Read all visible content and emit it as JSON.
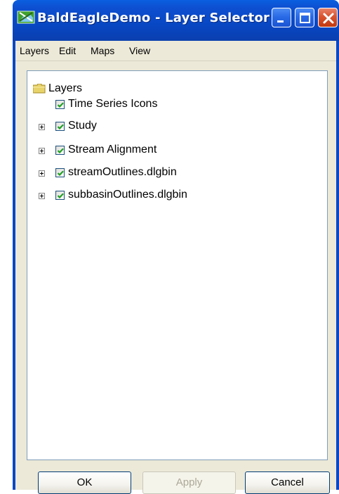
{
  "window": {
    "title": "BaldEagleDemo - Layer Selector"
  },
  "menu": {
    "items": [
      "Layers",
      "Edit",
      "Maps",
      "View"
    ]
  },
  "tree": {
    "root_label": "Layers",
    "root_icon": "folder-icon",
    "nodes": [
      {
        "label": "Time Series Icons",
        "checked": true,
        "expandable": false
      },
      {
        "label": "Study",
        "checked": true,
        "expandable": true
      },
      {
        "label": "Stream Alignment",
        "checked": true,
        "expandable": true
      },
      {
        "label": "streamOutlines.dlgbin",
        "checked": true,
        "expandable": true
      },
      {
        "label": "subbasinOutlines.dlgbin",
        "checked": true,
        "expandable": true
      }
    ]
  },
  "buttons": {
    "ok": "OK",
    "apply": "Apply",
    "cancel": "Cancel"
  },
  "colors": {
    "titlebar": "#0847c4",
    "check": "#21a121",
    "close_button": "#d9532e"
  }
}
